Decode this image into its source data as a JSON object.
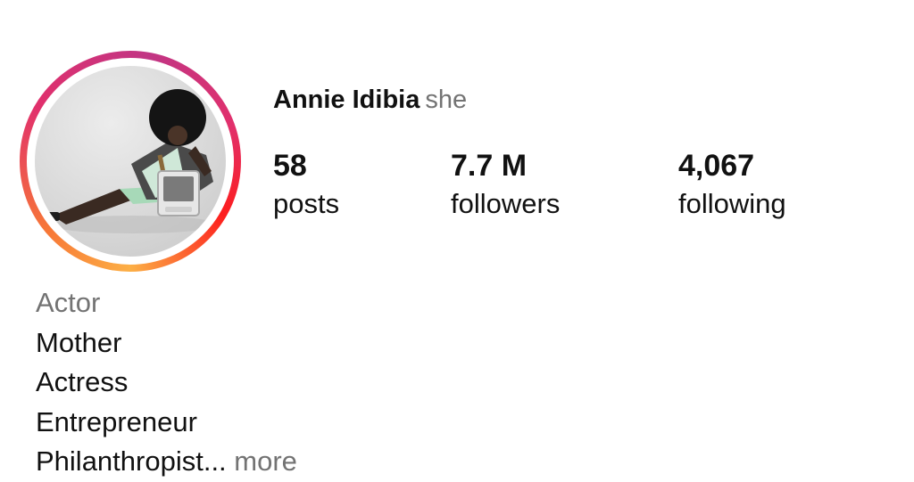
{
  "profile": {
    "name": "Annie Idibia",
    "pronouns": "she"
  },
  "stats": {
    "posts": {
      "value": "58",
      "label": "posts"
    },
    "followers": {
      "value": "7.7 M",
      "label": "followers"
    },
    "following": {
      "value": "4,067",
      "label": "following"
    }
  },
  "bio": {
    "category": "Actor",
    "lines": [
      "Mother",
      "Actress",
      "Entrepreneur"
    ],
    "last_line": "Philanthropist...",
    "more_label": "more"
  },
  "colors": {
    "text_primary": "#111111",
    "text_secondary": "#737373",
    "story_ring_start": "#fcaf45",
    "story_ring_end": "#c13584"
  },
  "icons": {
    "avatar": "profile-photo"
  }
}
